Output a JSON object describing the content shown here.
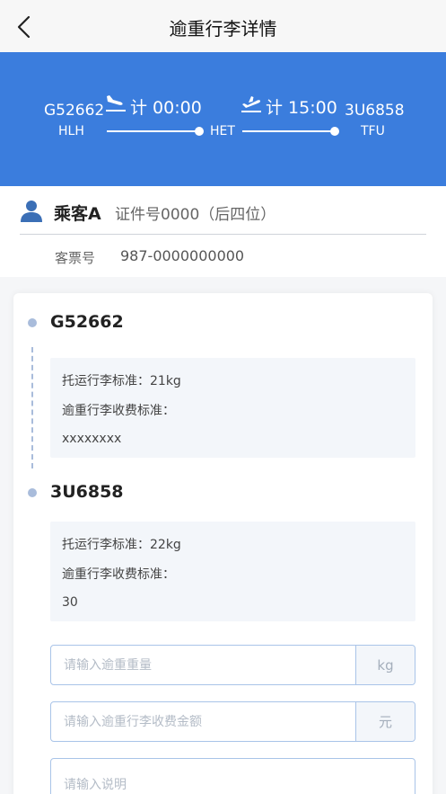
{
  "nav": {
    "title": "逾重行李详情",
    "back_icon": "chevron-left-icon"
  },
  "flight": {
    "origin_flight": "G52662",
    "origin_code": "HLH",
    "depart_time": "计 00:00",
    "transit_code": "HET",
    "arrive_time": "计 15:00",
    "dest_flight": "3U6858",
    "dest_code": "TFU",
    "takeoff_icon": "plane-takeoff-icon",
    "landing_icon": "plane-landing-icon"
  },
  "passenger": {
    "name": "乘客A",
    "id_text": "证件号0000（后四位）",
    "ticket_label": "客票号",
    "ticket_no": "987-0000000000",
    "icon": "person-icon"
  },
  "segments": [
    {
      "flight": "G52662",
      "allowance": "托运行李标准：21kg",
      "fee_label": "逾重行李收费标准：",
      "fee_value": "xxxxxxxx"
    },
    {
      "flight": "3U6858",
      "allowance": "托运行李标准：22kg",
      "fee_label": "逾重行李收费标准：",
      "fee_value": "30"
    }
  ],
  "form": {
    "weight_placeholder": "请输入逾重重量",
    "weight_unit": "kg",
    "amount_placeholder": "请输入逾重行李收费金额",
    "amount_unit": "元",
    "note_placeholder": "请输入说明"
  },
  "colors": {
    "banner": "#3b7ddd",
    "accent_border": "#a9c4e8",
    "dot": "#a9bcdb"
  }
}
